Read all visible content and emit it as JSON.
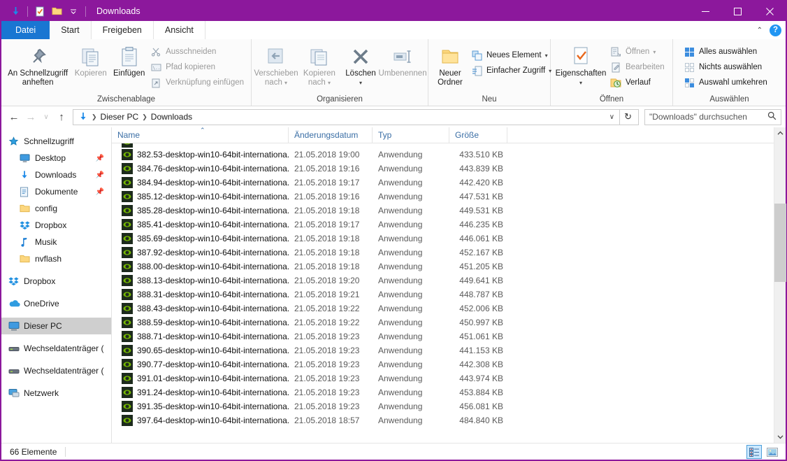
{
  "window": {
    "title": "Downloads",
    "quick_access": [
      {
        "name": "download-icon"
      },
      {
        "name": "checklist-icon"
      },
      {
        "name": "folder-icon"
      },
      {
        "name": "chevron-down-icon"
      }
    ],
    "controls": {
      "minimize": "—",
      "maximize": "☐",
      "close": "✕"
    },
    "accent_color": "#8c189c"
  },
  "tabs": [
    {
      "label": "Datei",
      "type": "file"
    },
    {
      "label": "Start",
      "type": "active"
    },
    {
      "label": "Freigeben",
      "type": "normal"
    },
    {
      "label": "Ansicht",
      "type": "normal"
    }
  ],
  "tab_right": {
    "collapse": "⌃",
    "help": "?"
  },
  "ribbon": {
    "groups": [
      {
        "label": "Zwischenablage",
        "big_buttons": [
          {
            "label": "An Schnellzugriff anheften",
            "icon": "pin-icon",
            "disabled": false
          },
          {
            "label": "Kopieren",
            "icon": "copy-icon",
            "disabled": true
          },
          {
            "label": "Einfügen",
            "icon": "paste-icon",
            "disabled": false
          }
        ],
        "small_buttons": [
          {
            "label": "Ausschneiden",
            "icon": "scissors-icon",
            "disabled": true
          },
          {
            "label": "Pfad kopieren",
            "icon": "copy-path-icon",
            "disabled": true
          },
          {
            "label": "Verknüpfung einfügen",
            "icon": "paste-shortcut-icon",
            "disabled": true
          }
        ]
      },
      {
        "label": "Organisieren",
        "big_buttons": [
          {
            "label": "Verschieben nach",
            "icon": "move-to-icon",
            "disabled": true,
            "caret": true
          },
          {
            "label": "Kopieren nach",
            "icon": "copy-to-icon",
            "disabled": true,
            "caret": true
          },
          {
            "label": "Löschen",
            "icon": "delete-icon",
            "disabled": false,
            "caret": true
          },
          {
            "label": "Umbenennen",
            "icon": "rename-icon",
            "disabled": true
          }
        ],
        "small_buttons": []
      },
      {
        "label": "Neu",
        "big_buttons": [
          {
            "label": "Neuer Ordner",
            "icon": "new-folder-icon",
            "disabled": false
          }
        ],
        "small_buttons": [
          {
            "label": "Neues Element",
            "icon": "new-item-icon",
            "disabled": false,
            "caret": true
          },
          {
            "label": "Einfacher Zugriff",
            "icon": "easy-access-icon",
            "disabled": false,
            "caret": true
          }
        ]
      },
      {
        "label": "Öffnen",
        "big_buttons": [
          {
            "label": "Eigenschaften",
            "icon": "properties-icon",
            "disabled": false,
            "caret": true
          }
        ],
        "small_buttons": [
          {
            "label": "Öffnen",
            "icon": "open-icon",
            "disabled": true,
            "caret": true
          },
          {
            "label": "Bearbeiten",
            "icon": "edit-icon",
            "disabled": true
          },
          {
            "label": "Verlauf",
            "icon": "history-icon",
            "disabled": false
          }
        ]
      },
      {
        "label": "Auswählen",
        "big_buttons": [],
        "small_buttons": [
          {
            "label": "Alles auswählen",
            "icon": "select-all-icon",
            "disabled": false
          },
          {
            "label": "Nichts auswählen",
            "icon": "select-none-icon",
            "disabled": false
          },
          {
            "label": "Auswahl umkehren",
            "icon": "invert-selection-icon",
            "disabled": false
          }
        ]
      }
    ]
  },
  "address": {
    "back": "←",
    "forward": "→",
    "recent": "∨",
    "up": "↑",
    "breadcrumbs": [
      "Dieser PC",
      "Downloads"
    ],
    "dropdown_caret": "∨",
    "refresh": "↻",
    "search_placeholder": "\"Downloads\" durchsuchen",
    "search_value": ""
  },
  "sidebar": {
    "items": [
      {
        "label": "Schnellzugriff",
        "icon": "star-icon",
        "indent": false,
        "pinned": false,
        "selected": false,
        "gap_before": false
      },
      {
        "label": "Desktop",
        "icon": "desktop-icon",
        "indent": true,
        "pinned": true,
        "selected": false,
        "gap_before": false
      },
      {
        "label": "Downloads",
        "icon": "download-icon",
        "indent": true,
        "pinned": true,
        "selected": false,
        "gap_before": false
      },
      {
        "label": "Dokumente",
        "icon": "documents-icon",
        "indent": true,
        "pinned": true,
        "selected": false,
        "gap_before": false
      },
      {
        "label": "config",
        "icon": "folder-icon",
        "indent": true,
        "pinned": false,
        "selected": false,
        "gap_before": false
      },
      {
        "label": "Dropbox",
        "icon": "dropbox-icon",
        "indent": true,
        "pinned": false,
        "selected": false,
        "gap_before": false
      },
      {
        "label": "Musik",
        "icon": "music-icon",
        "indent": true,
        "pinned": false,
        "selected": false,
        "gap_before": false
      },
      {
        "label": "nvflash",
        "icon": "folder-icon",
        "indent": true,
        "pinned": false,
        "selected": false,
        "gap_before": false
      },
      {
        "label": "Dropbox",
        "icon": "dropbox-icon",
        "indent": false,
        "pinned": false,
        "selected": false,
        "gap_before": true
      },
      {
        "label": "OneDrive",
        "icon": "onedrive-icon",
        "indent": false,
        "pinned": false,
        "selected": false,
        "gap_before": true
      },
      {
        "label": "Dieser PC",
        "icon": "pc-icon",
        "indent": false,
        "pinned": false,
        "selected": true,
        "gap_before": true
      },
      {
        "label": "Wechseldatenträger (",
        "icon": "drive-icon",
        "indent": false,
        "pinned": false,
        "selected": false,
        "gap_before": true
      },
      {
        "label": "Wechseldatenträger (",
        "icon": "drive-icon",
        "indent": false,
        "pinned": false,
        "selected": false,
        "gap_before": true
      },
      {
        "label": "Netzwerk",
        "icon": "network-icon",
        "indent": false,
        "pinned": false,
        "selected": false,
        "gap_before": true
      }
    ]
  },
  "filelist": {
    "columns": [
      {
        "label": "Name",
        "sorted": true
      },
      {
        "label": "Änderungsdatum",
        "sorted": false
      },
      {
        "label": "Typ",
        "sorted": false
      },
      {
        "label": "Größe",
        "sorted": false
      }
    ],
    "rows": [
      {
        "name": "382.53-desktop-win10-64bit-internationa...",
        "date": "21.05.2018 19:00",
        "type": "Anwendung",
        "size": "433.510 KB"
      },
      {
        "name": "384.76-desktop-win10-64bit-internationa...",
        "date": "21.05.2018 19:16",
        "type": "Anwendung",
        "size": "443.839 KB"
      },
      {
        "name": "384.94-desktop-win10-64bit-internationa...",
        "date": "21.05.2018 19:17",
        "type": "Anwendung",
        "size": "442.420 KB"
      },
      {
        "name": "385.12-desktop-win10-64bit-internationa...",
        "date": "21.05.2018 19:16",
        "type": "Anwendung",
        "size": "447.531 KB"
      },
      {
        "name": "385.28-desktop-win10-64bit-internationa...",
        "date": "21.05.2018 19:18",
        "type": "Anwendung",
        "size": "449.531 KB"
      },
      {
        "name": "385.41-desktop-win10-64bit-internationa...",
        "date": "21.05.2018 19:17",
        "type": "Anwendung",
        "size": "446.235 KB"
      },
      {
        "name": "385.69-desktop-win10-64bit-internationa...",
        "date": "21.05.2018 19:18",
        "type": "Anwendung",
        "size": "446.061 KB"
      },
      {
        "name": "387.92-desktop-win10-64bit-internationa...",
        "date": "21.05.2018 19:18",
        "type": "Anwendung",
        "size": "452.167 KB"
      },
      {
        "name": "388.00-desktop-win10-64bit-internationa...",
        "date": "21.05.2018 19:18",
        "type": "Anwendung",
        "size": "451.205 KB"
      },
      {
        "name": "388.13-desktop-win10-64bit-internationa...",
        "date": "21.05.2018 19:20",
        "type": "Anwendung",
        "size": "449.641 KB"
      },
      {
        "name": "388.31-desktop-win10-64bit-internationa...",
        "date": "21.05.2018 19:21",
        "type": "Anwendung",
        "size": "448.787 KB"
      },
      {
        "name": "388.43-desktop-win10-64bit-internationa...",
        "date": "21.05.2018 19:22",
        "type": "Anwendung",
        "size": "452.006 KB"
      },
      {
        "name": "388.59-desktop-win10-64bit-internationa...",
        "date": "21.05.2018 19:22",
        "type": "Anwendung",
        "size": "450.997 KB"
      },
      {
        "name": "388.71-desktop-win10-64bit-internationa...",
        "date": "21.05.2018 19:23",
        "type": "Anwendung",
        "size": "451.061 KB"
      },
      {
        "name": "390.65-desktop-win10-64bit-internationa...",
        "date": "21.05.2018 19:23",
        "type": "Anwendung",
        "size": "441.153 KB"
      },
      {
        "name": "390.77-desktop-win10-64bit-internationa...",
        "date": "21.05.2018 19:23",
        "type": "Anwendung",
        "size": "442.308 KB"
      },
      {
        "name": "391.01-desktop-win10-64bit-internationa...",
        "date": "21.05.2018 19:23",
        "type": "Anwendung",
        "size": "443.974 KB"
      },
      {
        "name": "391.24-desktop-win10-64bit-internationa...",
        "date": "21.05.2018 19:23",
        "type": "Anwendung",
        "size": "453.884 KB"
      },
      {
        "name": "391.35-desktop-win10-64bit-internationa...",
        "date": "21.05.2018 19:23",
        "type": "Anwendung",
        "size": "456.081 KB"
      },
      {
        "name": "397.64-desktop-win10-64bit-internationa...",
        "date": "21.05.2018 18:57",
        "type": "Anwendung",
        "size": "484.840 KB"
      }
    ]
  },
  "statusbar": {
    "count_text": "66 Elemente",
    "views": [
      {
        "name": "details-view",
        "selected": true
      },
      {
        "name": "large-icons-view",
        "selected": false
      }
    ]
  }
}
